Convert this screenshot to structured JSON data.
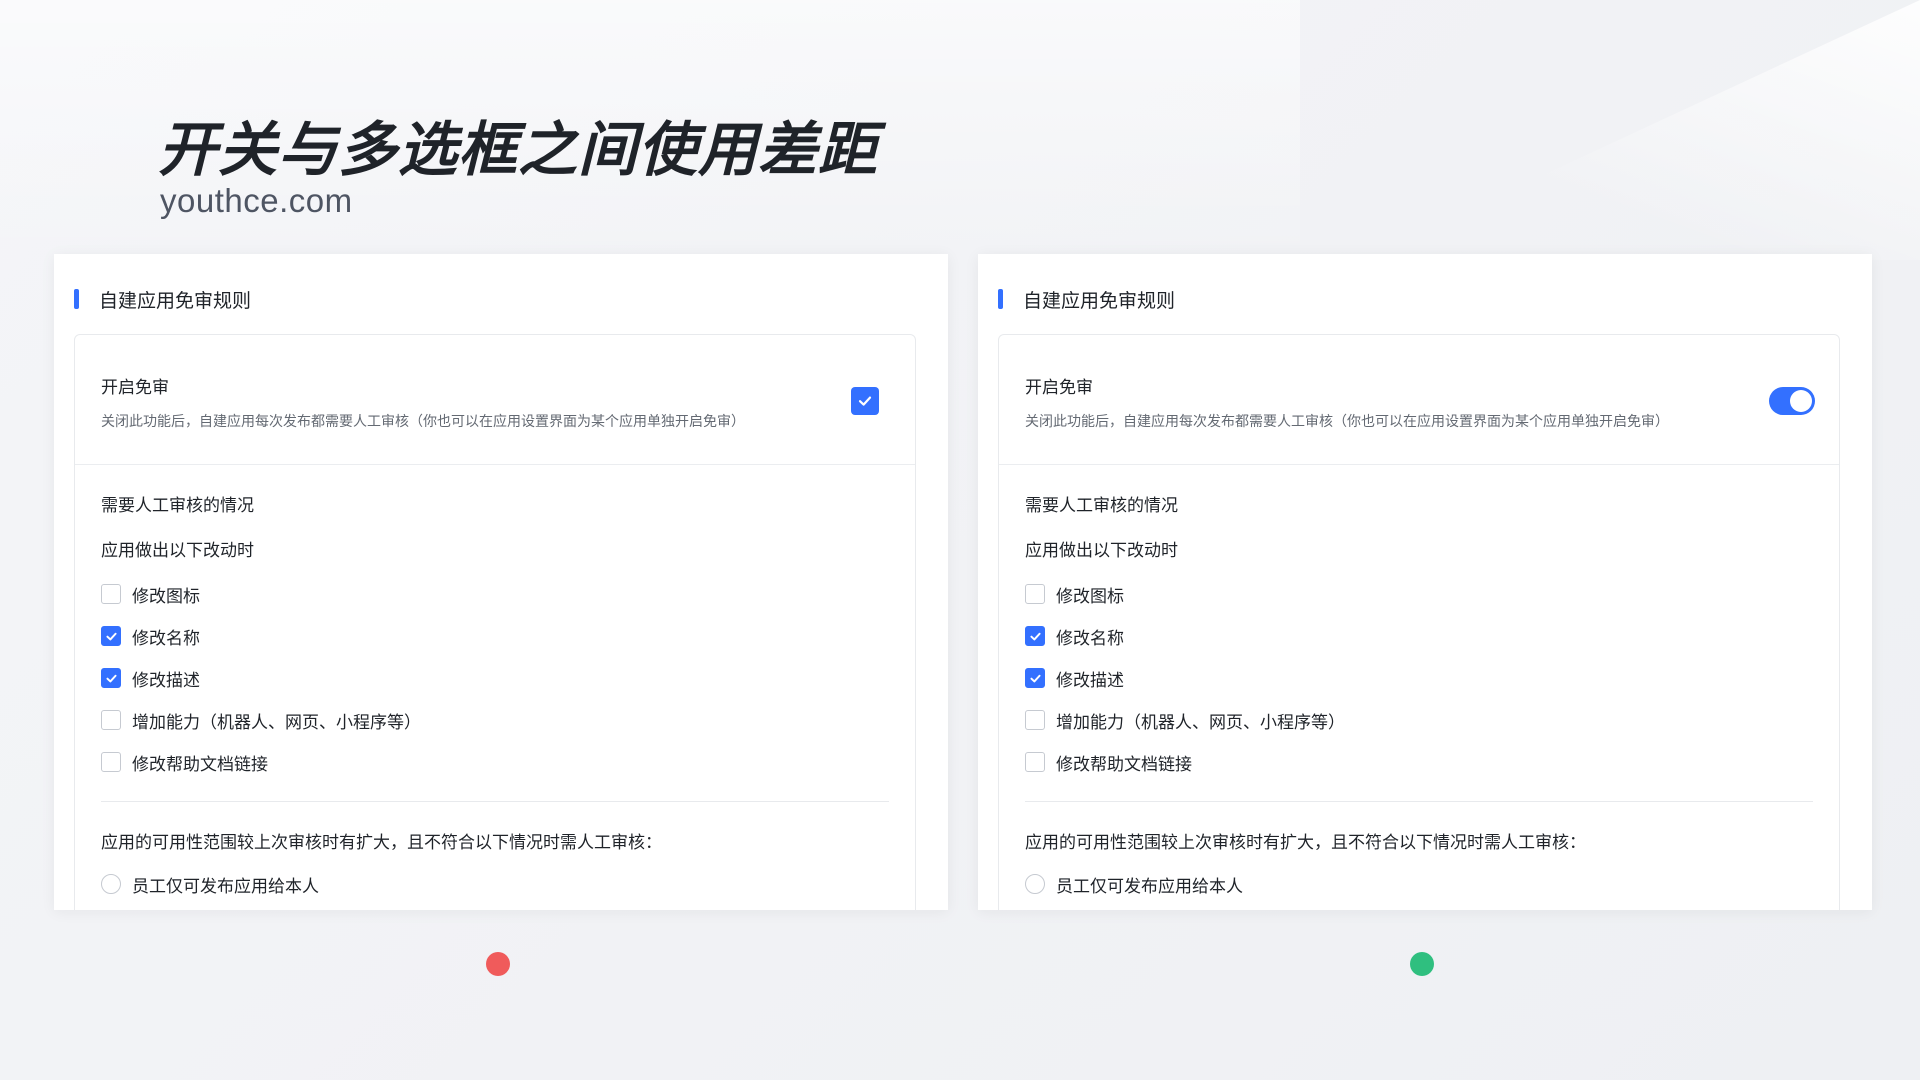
{
  "page": {
    "title": "开关与多选框之间使用差距",
    "subtitle": "youthce.com"
  },
  "colors": {
    "accent": "#3370ff",
    "bad_dot": "#f05b5b",
    "good_dot": "#2fbf7f"
  },
  "panels": [
    {
      "variant": "checkbox",
      "status": "bad",
      "header": "自建应用免审规则",
      "setting": {
        "title": "开启免审",
        "desc": "关闭此功能后，自建应用每次发布都需要人工审核（你也可以在应用设置界面为某个应用单独开启免审）",
        "enabled": true,
        "control_icon": "checkbox-checked-icon"
      },
      "section_title": "需要人工审核的情况",
      "subsection_title": "应用做出以下改动时",
      "items": [
        {
          "label": "修改图标",
          "checked": false
        },
        {
          "label": "修改名称",
          "checked": true
        },
        {
          "label": "修改描述",
          "checked": true
        },
        {
          "label": "增加能力（机器人、网页、小程序等）",
          "checked": false
        },
        {
          "label": "修改帮助文档链接",
          "checked": false
        }
      ],
      "scope_title": "应用的可用性范围较上次审核时有扩大，且不符合以下情况时需人工审核：",
      "radio": {
        "label": "员工仅可发布应用给本人",
        "selected": false
      }
    },
    {
      "variant": "toggle",
      "status": "good",
      "header": "自建应用免审规则",
      "setting": {
        "title": "开启免审",
        "desc": "关闭此功能后，自建应用每次发布都需要人工审核（你也可以在应用设置界面为某个应用单独开启免审）",
        "enabled": true,
        "control_icon": "toggle-on-icon"
      },
      "section_title": "需要人工审核的情况",
      "subsection_title": "应用做出以下改动时",
      "items": [
        {
          "label": "修改图标",
          "checked": false
        },
        {
          "label": "修改名称",
          "checked": true
        },
        {
          "label": "修改描述",
          "checked": true
        },
        {
          "label": "增加能力（机器人、网页、小程序等）",
          "checked": false
        },
        {
          "label": "修改帮助文档链接",
          "checked": false
        }
      ],
      "scope_title": "应用的可用性范围较上次审核时有扩大，且不符合以下情况时需人工审核：",
      "radio": {
        "label": "员工仅可发布应用给本人",
        "selected": false
      }
    }
  ]
}
